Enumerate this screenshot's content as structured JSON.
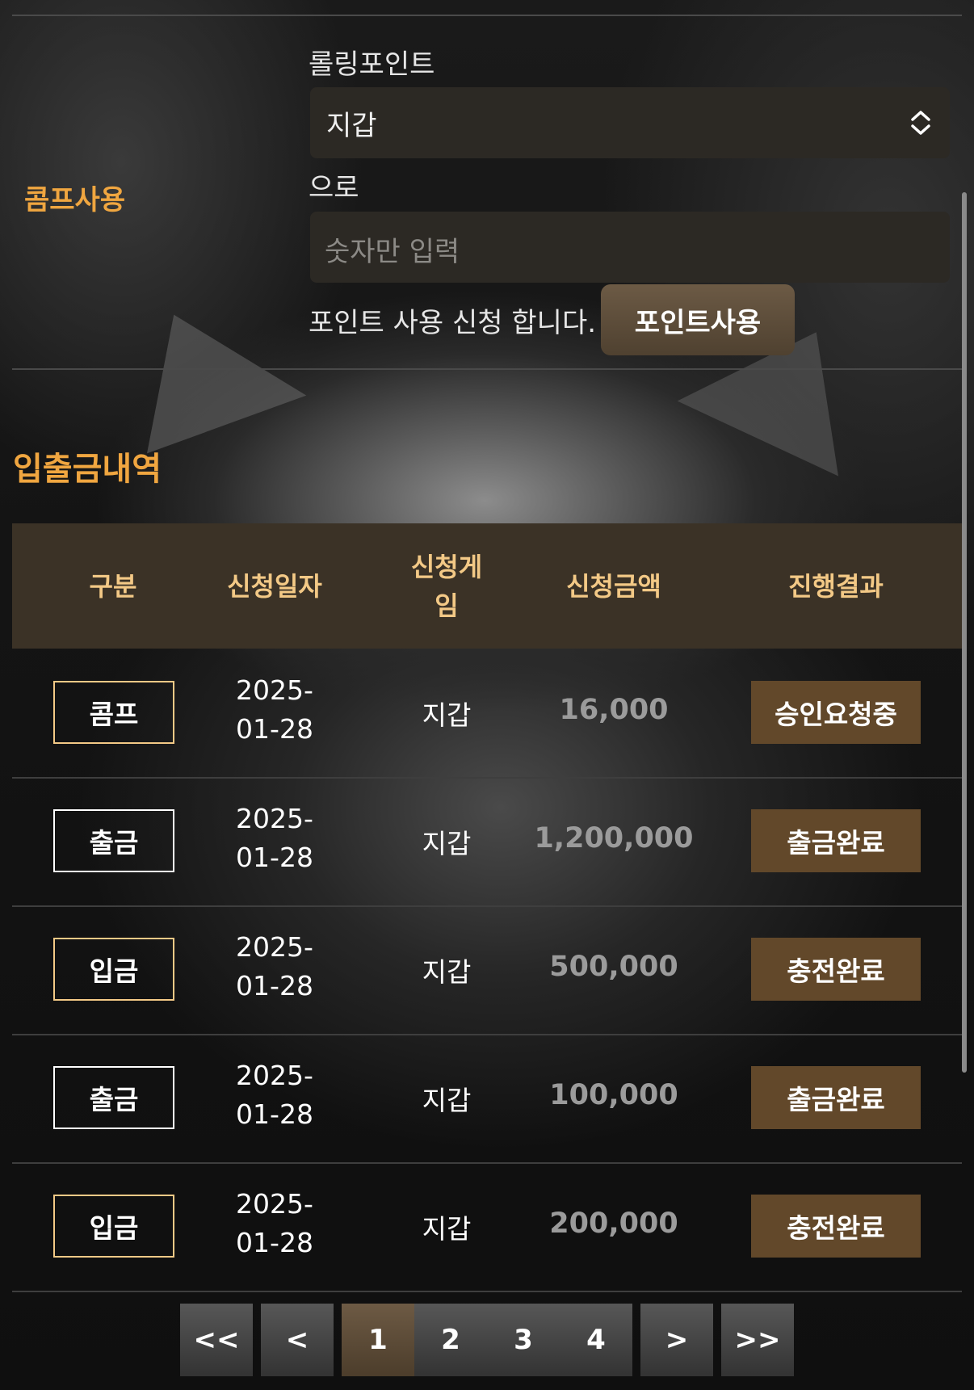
{
  "comp": {
    "label": "콤프사용",
    "rolling_label": "롤링포인트",
    "select_value": "지갑",
    "to_label": "으로",
    "amount_placeholder": "숫자만 입력",
    "request_text": "포인트 사용 신청 합니다.",
    "button_label": "포인트사용"
  },
  "history": {
    "title": "입출금내역",
    "headers": [
      "구분",
      "신청일자",
      "신청게임",
      "신청금액",
      "진행결과"
    ],
    "rows": [
      {
        "type": "콤프",
        "date": "2025-01-28",
        "game": "지갑",
        "amount": "16,000",
        "status": "승인요청중"
      },
      {
        "type": "출금",
        "date": "2025-01-28",
        "game": "지갑",
        "amount": "1,200,000",
        "status": "출금완료"
      },
      {
        "type": "입금",
        "date": "2025-01-28",
        "game": "지갑",
        "amount": "500,000",
        "status": "충전완료"
      },
      {
        "type": "출금",
        "date": "2025-01-28",
        "game": "지갑",
        "amount": "100,000",
        "status": "출금완료"
      },
      {
        "type": "입금",
        "date": "2025-01-28",
        "game": "지갑",
        "amount": "200,000",
        "status": "충전완료"
      }
    ]
  },
  "pagination": {
    "first": "<<",
    "prev": "<",
    "pages": [
      "1",
      "2",
      "3",
      "4"
    ],
    "current": "1",
    "next": ">",
    "last": ">>"
  },
  "colors": {
    "accent": "#f0a640",
    "header_bg": "#3b3226",
    "header_text": "#f3c986",
    "status_bg": "#62482a"
  }
}
